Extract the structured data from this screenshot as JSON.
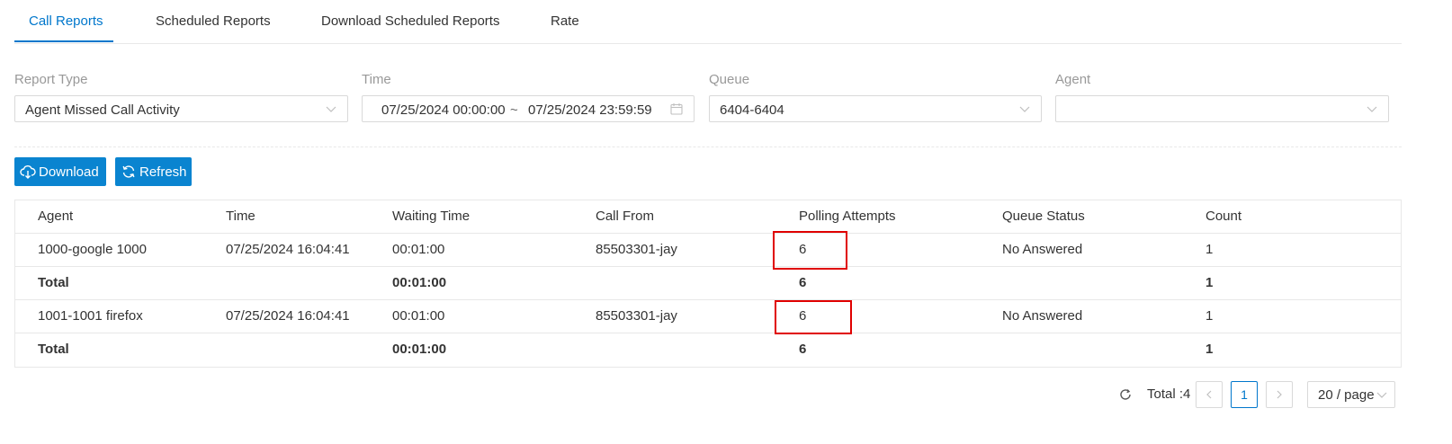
{
  "tabs": [
    {
      "label": "Call Reports",
      "active": true
    },
    {
      "label": "Scheduled Reports",
      "active": false
    },
    {
      "label": "Download Scheduled Reports",
      "active": false
    },
    {
      "label": "Rate",
      "active": false
    }
  ],
  "filters": {
    "report_type": {
      "label": "Report Type",
      "value": "Agent Missed Call Activity"
    },
    "time": {
      "label": "Time",
      "start": "07/25/2024 00:00:00",
      "separator": "~",
      "end": "07/25/2024 23:59:59"
    },
    "queue": {
      "label": "Queue",
      "value": "6404-6404"
    },
    "agent": {
      "label": "Agent",
      "value": ""
    }
  },
  "actions": {
    "download_label": "Download",
    "refresh_label": "Refresh"
  },
  "table": {
    "columns": [
      "Agent",
      "Time",
      "Waiting Time",
      "Call From",
      "Polling Attempts",
      "Queue Status",
      "Count"
    ],
    "rows": [
      {
        "agent": "1000-google 1000",
        "time": "07/25/2024 16:04:41",
        "waiting_time": "00:01:00",
        "call_from": "85503301-jay",
        "polling_attempts": "6",
        "queue_status": "No Answered",
        "count": "1"
      },
      {
        "agent": "Total",
        "time": "",
        "waiting_time": "00:01:00",
        "call_from": "",
        "polling_attempts": "6",
        "queue_status": "",
        "count": "1",
        "is_total": true
      },
      {
        "agent": "1001-1001 firefox",
        "time": "07/25/2024 16:04:41",
        "waiting_time": "00:01:00",
        "call_from": "85503301-jay",
        "polling_attempts": "6",
        "queue_status": "No Answered",
        "count": "1"
      },
      {
        "agent": "Total",
        "time": "",
        "waiting_time": "00:01:00",
        "call_from": "",
        "polling_attempts": "6",
        "queue_status": "",
        "count": "1",
        "is_total": true
      }
    ]
  },
  "pagination": {
    "total_text": "Total :4",
    "current_page": "1",
    "page_size": "20 / page"
  },
  "colors": {
    "accent": "#0077cc",
    "button": "#0a84d0",
    "highlight": "#e00000"
  }
}
